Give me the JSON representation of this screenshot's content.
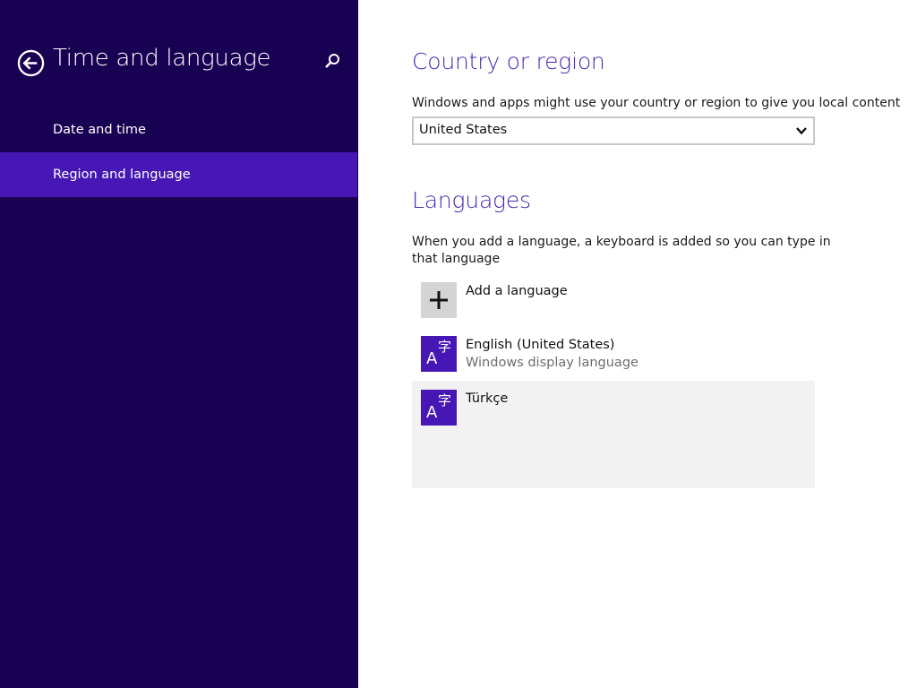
{
  "colors": {
    "sidebar_bg": "#180052",
    "selected_bg": "#4617b4",
    "accent_title": "#4a2ab0",
    "tile_lang": "#4617b4",
    "tile_add": "#d4d4d4",
    "selected_row_bg": "#f2f2f2"
  },
  "sidebar": {
    "back_icon": "back-arrow-circle-icon",
    "title": "Time and language",
    "search_icon": "search-icon",
    "items": [
      {
        "label": "Date and time",
        "selected": false
      },
      {
        "label": "Region and language",
        "selected": true
      }
    ]
  },
  "country": {
    "title": "Country or region",
    "description": "Windows and apps might use your country or region to give you local content",
    "selected": "United States"
  },
  "languages": {
    "title": "Languages",
    "description": "When you add a language, a keyboard is added so you can type in that language",
    "add_label": "Add a language",
    "items": [
      {
        "name": "English (United States)",
        "subtitle": "Windows display language"
      },
      {
        "name": "Türkçe",
        "subtitle": ""
      }
    ]
  }
}
